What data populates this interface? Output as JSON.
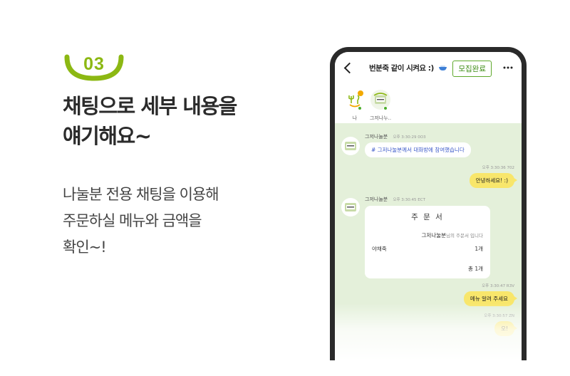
{
  "promo": {
    "step_number": "03",
    "headline_line1": "채팅으로 세부 내용을",
    "headline_line2": "얘기해요~",
    "body_line1": "나눌분 전용 채팅을 이용해",
    "body_line2": "주문하실 메뉴와 금액을",
    "body_line3": "확인~!",
    "accent_color": "#8cb813"
  },
  "chat_room": {
    "title": "번분죽 같이 시켜요 :)",
    "title_icon": "bowl-icon",
    "recruit_button": "모집완료",
    "members": [
      {
        "name": "나",
        "icon": "cutlery-leaf-avatar"
      },
      {
        "name": "그저나누..",
        "icon": "store-avatar"
      }
    ],
    "messages": [
      {
        "sender": "그저나눌분",
        "time": "오후 3:30:29",
        "tag": "0O3",
        "text": "# 그저나눌분께서 대화방에 참여했습니다"
      },
      {
        "time": "오후 3:30:36",
        "tag": "702",
        "text": "안녕하세요! :)"
      },
      {
        "sender": "그저나눌분",
        "time": "오후 3:30:45",
        "tag": "ECT"
      },
      {
        "time": "오후 3:30:47",
        "tag": "R3V",
        "text": "메뉴 알려 주세요"
      },
      {
        "time": "오후 3:30:57",
        "tag": "ZN",
        "text": "오!"
      }
    ],
    "order_card": {
      "title": "주 문 서",
      "owner": "그저나눌분",
      "owner_suffix": "님의 주문서 입니다",
      "item_name": "야채죽",
      "item_qty": "1개",
      "total": "총 1개"
    },
    "colors": {
      "chat_bg": "#e4f0da",
      "my_bubble": "#f8e66b",
      "brand_green": "#5ea82b"
    }
  }
}
